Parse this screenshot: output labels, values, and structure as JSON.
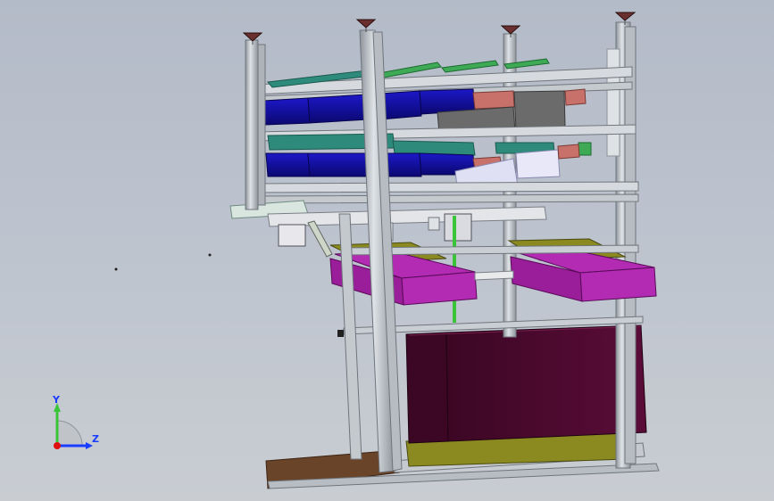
{
  "viewport": {
    "background_top": "#b4bbc8",
    "background_bottom": "#c9cdd2"
  },
  "colors": {
    "frame": "#c9ced4",
    "frame_edge": "#6f757c",
    "bin_blue": "#1410a8",
    "bin_blue_dark": "#0b0870",
    "teal": "#2e8b7c",
    "green": "#3faa55",
    "salmon": "#c8706a",
    "gray_block": "#6b6b6b",
    "lavender": "#e0e0f4",
    "magenta": "#b22bb2",
    "olive": "#8a8a20",
    "dark_maroon": "#4a0a2e",
    "brown": "#6a4428",
    "funnel": "#6a2f2f"
  },
  "triad": {
    "y_label": "Y",
    "z_label": "Z",
    "y_color": "#3ac43a",
    "z_color": "#1a3cff",
    "origin_color": "#e01010"
  },
  "icons": [
    "coordinate-triad-icon"
  ]
}
